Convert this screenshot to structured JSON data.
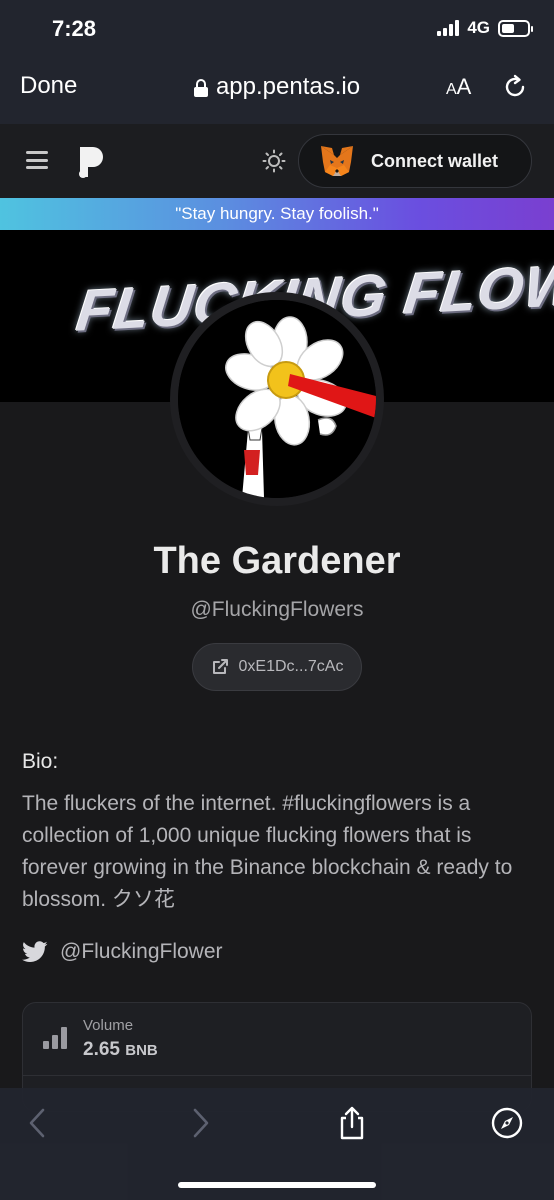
{
  "status": {
    "time": "7:28",
    "network": "4G"
  },
  "browser": {
    "done_label": "Done",
    "url": "app.pentas.io",
    "text_size_label": "AA"
  },
  "nav": {
    "connect_wallet_label": "Connect wallet"
  },
  "banner": {
    "quote": "\"Stay hungry. Stay foolish.\""
  },
  "cover": {
    "title": "FLUCKING FLOWERS™"
  },
  "profile": {
    "name": "The Gardener",
    "handle": "@FluckingFlowers",
    "address": "0xE1Dc...7cAc",
    "bio_label": "Bio:",
    "bio": "The fluckers of the internet. #fluckingflowers is a collection of 1,000 unique flucking flowers that is forever growing in the Binance blockchain & ready to blossom. クソ花",
    "twitter": "@FluckingFlower"
  },
  "stats": {
    "volume_label": "Volume",
    "volume_value": "2.65",
    "volume_unit": "BNB"
  },
  "colors": {
    "accent_gradient_start": "#4fc3e0",
    "accent_gradient_end": "#7a3fd0",
    "background": "#19191b"
  },
  "icons": [
    "lock-icon",
    "reload-icon",
    "menu-icon",
    "sun-icon",
    "metamask-fox-icon",
    "external-link-icon",
    "twitter-icon",
    "bar-chart-icon",
    "back-icon",
    "forward-icon",
    "share-icon",
    "compass-icon"
  ]
}
